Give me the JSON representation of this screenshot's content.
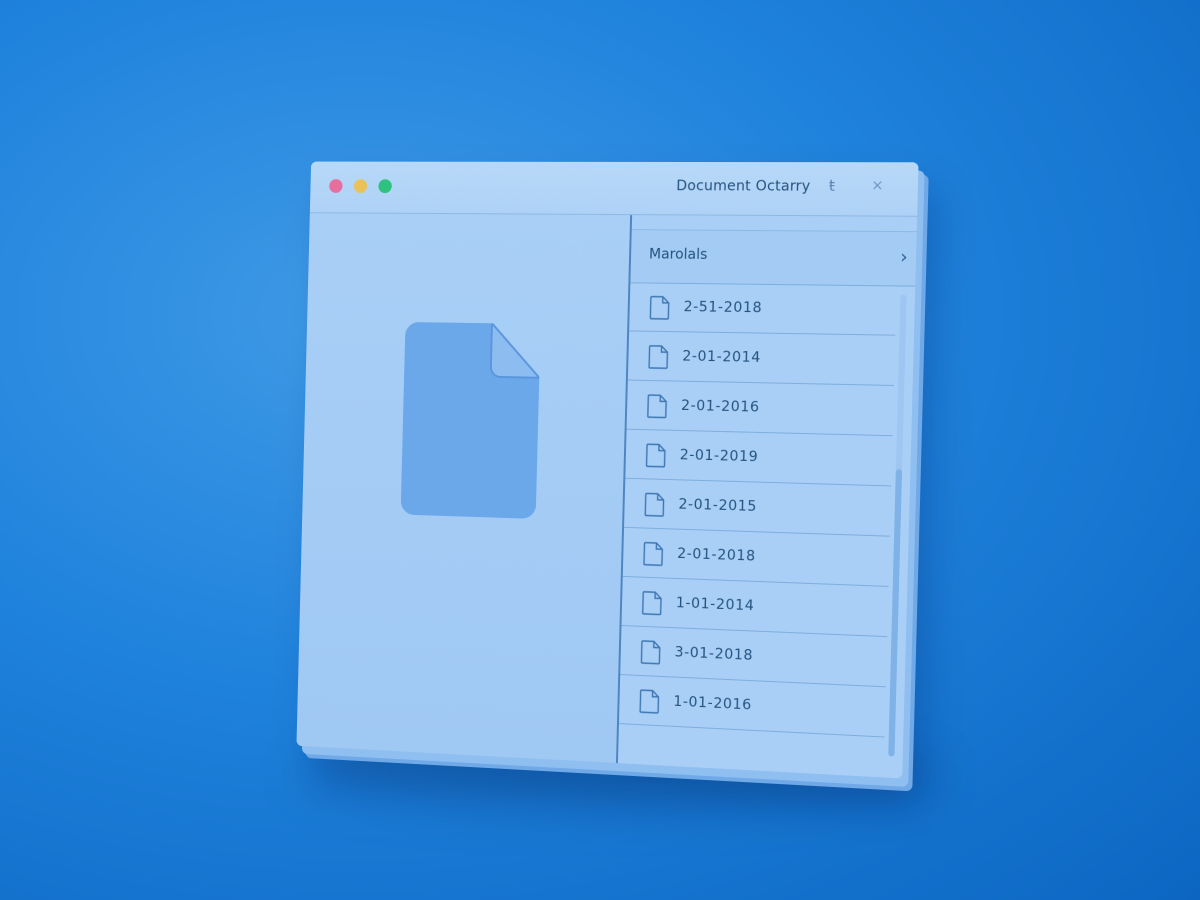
{
  "window": {
    "title": "Document Octarry",
    "pin_glyph": "ŧ",
    "close_glyph": "×"
  },
  "traffic_lights": {
    "close_color": "#e66f9e",
    "minimize_color": "#e9c25a",
    "zoom_color": "#2ec27e"
  },
  "list": {
    "header_label": "Marolals",
    "header_chevron": "›",
    "items": [
      {
        "label": "2-51-2018"
      },
      {
        "label": "2-01-2014"
      },
      {
        "label": "2-01-2016"
      },
      {
        "label": "2-01-2019"
      },
      {
        "label": "2-01-2015"
      },
      {
        "label": "2-01-2018"
      },
      {
        "label": "1-01-2014"
      },
      {
        "label": "3-01-2018"
      },
      {
        "label": "1-01-2016"
      }
    ]
  },
  "preview": {
    "icon": "document-icon"
  },
  "colors": {
    "background": "#1f82dc",
    "window": "#a9cff6",
    "text": "#24527f",
    "divider": "#4f86c2"
  }
}
